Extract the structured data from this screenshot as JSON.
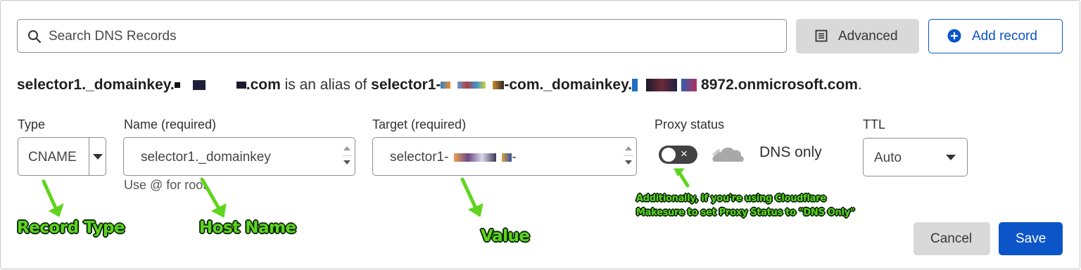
{
  "search": {
    "placeholder": "Search DNS Records"
  },
  "toolbar": {
    "advanced_label": "Advanced",
    "add_record_label": "Add record"
  },
  "alias_line": {
    "name_prefix": "selector1._domainkey.",
    "name_suffix": ".com",
    "middle_text": " is an alias of ",
    "target_prefix": "selector1-",
    "target_middle": "-com._domainkey.",
    "target_suffix": "8972.onmicrosoft.com",
    "end": "."
  },
  "form": {
    "type_label": "Type",
    "type_value": "CNAME",
    "name_label": "Name (required)",
    "name_value": "selector1._domainkey",
    "name_hint": "Use @ for root",
    "target_label": "Target (required)",
    "target_value": "selector1-",
    "target_value_suffix": "-",
    "proxy_label": "Proxy status",
    "proxy_toggle_symbol": "×",
    "proxy_value": "DNS only",
    "ttl_label": "TTL",
    "ttl_value": "Auto"
  },
  "actions": {
    "cancel_label": "Cancel",
    "save_label": "Save"
  },
  "annotations": {
    "record_type": "Record Type",
    "host_name": "Host Name",
    "value": "Value",
    "proxy_note_line1": "Additionally, if you're using Cloudflare",
    "proxy_note_line2": "Makesure to set Proxy Status to \"DNS Only\""
  },
  "colors": {
    "accent": "#0a55c8",
    "annotation": "#5fd41e",
    "toggle_off": "#424242"
  }
}
